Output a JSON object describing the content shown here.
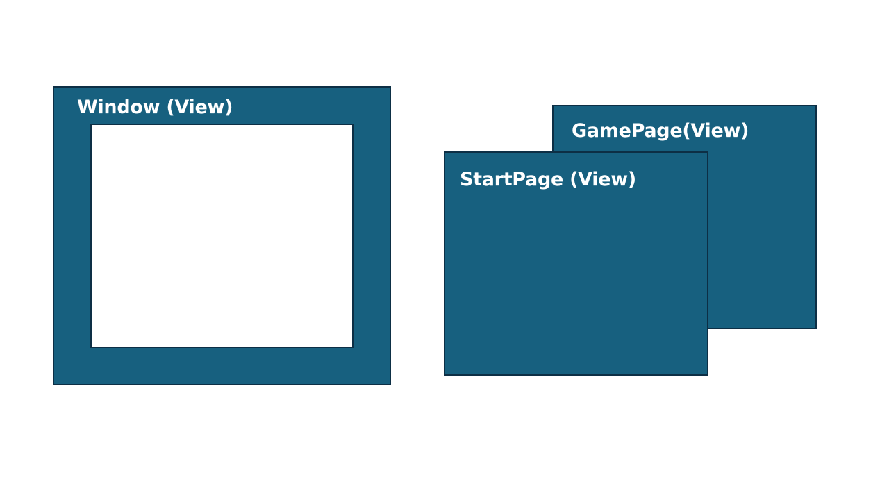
{
  "colors": {
    "view_fill": "#17607f",
    "border": "#0d2f45",
    "inner_fill": "#ffffff",
    "label_text": "#ffffff",
    "background": "#ffffff"
  },
  "window": {
    "label": "Window (View)"
  },
  "game_page": {
    "label": "GamePage(View)"
  },
  "start_page": {
    "label": "StartPage (View)"
  }
}
